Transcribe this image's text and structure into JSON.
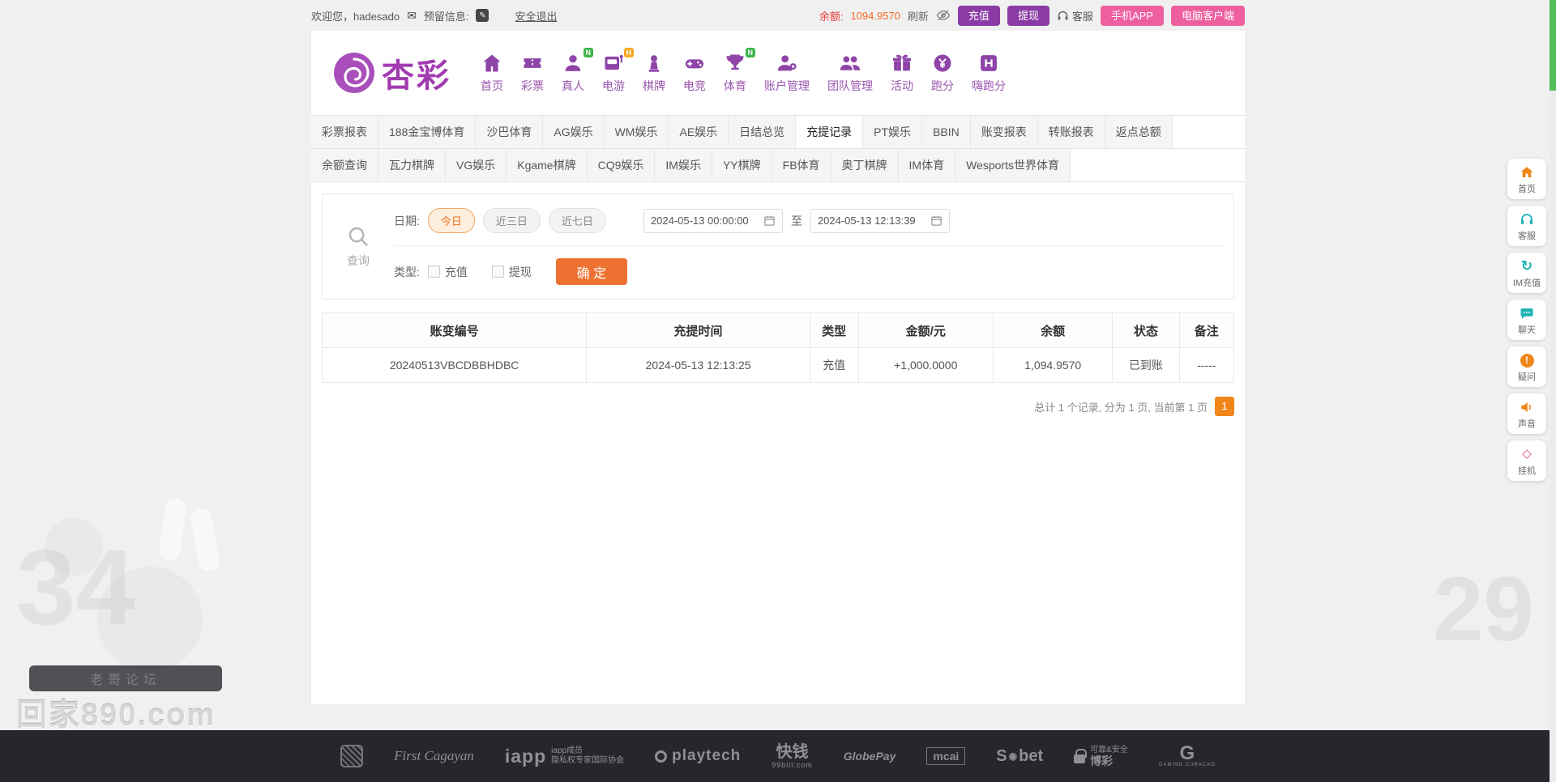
{
  "colors": {
    "accent_purple": "#8a3ba5",
    "accent_pink": "#ee5fa0",
    "accent_orange": "#f08519",
    "amount_red": "#e0262b",
    "status_green": "#3ba54d"
  },
  "topbar": {
    "welcome": "欢迎您，hadesado",
    "reserved_label": "预留信息:",
    "logout": "安全退出",
    "balance_label": "余额:",
    "balance_value": "1094.9570",
    "refresh": "刷新",
    "deposit": "充值",
    "withdraw": "提现",
    "service": "客服",
    "mobile_app": "手机APP",
    "pc_client": "电脑客户端"
  },
  "brand": {
    "name": "杏彩"
  },
  "nav": {
    "items": [
      {
        "label": "首页",
        "badge": ""
      },
      {
        "label": "彩票",
        "badge": ""
      },
      {
        "label": "真人",
        "badge": "N"
      },
      {
        "label": "电游",
        "badge": "H"
      },
      {
        "label": "棋牌",
        "badge": ""
      },
      {
        "label": "电竞",
        "badge": ""
      },
      {
        "label": "体育",
        "badge": "N"
      },
      {
        "label": "账户管理",
        "badge": ""
      },
      {
        "label": "团队管理",
        "badge": ""
      },
      {
        "label": "活动",
        "badge": ""
      },
      {
        "label": "跑分",
        "badge": ""
      },
      {
        "label": "嗨跑分",
        "badge": ""
      }
    ]
  },
  "tabs": {
    "row1": [
      "彩票报表",
      "188金宝博体育",
      "沙巴体育",
      "AG娱乐",
      "WM娱乐",
      "AE娱乐",
      "日结总览",
      "充提记录",
      "PT娱乐",
      "BBIN",
      "账变报表",
      "转账报表",
      "返点总额"
    ],
    "row2": [
      "余额查询",
      "瓦力棋牌",
      "VG娱乐",
      "Kgame棋牌",
      "CQ9娱乐",
      "IM娱乐",
      "YY棋牌",
      "FB体育",
      "奥丁棋牌",
      "IM体育",
      "Wesports世界体育"
    ]
  },
  "filter": {
    "search_label": "查询",
    "date_label": "日期:",
    "quick": [
      "今日",
      "近三日",
      "近七日"
    ],
    "date_from": "2024-05-13 00:00:00",
    "to_label": "至",
    "date_to": "2024-05-13 12:13:39",
    "type_label": "类型:",
    "types": [
      "充值",
      "提现"
    ],
    "confirm": "确 定"
  },
  "table": {
    "headers": [
      "账变编号",
      "充提时间",
      "类型",
      "金额/元",
      "余额",
      "状态",
      "备注"
    ],
    "rows": [
      {
        "id": "20240513VBCDBBHDBC",
        "time": "2024-05-13 12:13:25",
        "type": "充值",
        "amount": "+1,000.0000",
        "balance": "1,094.9570",
        "status": "已到账",
        "remark": "-----"
      }
    ]
  },
  "pagination": {
    "summary": "总计 1 个记录, 分为 1 页, 当前第 1 页",
    "current": "1"
  },
  "side_nav": {
    "items": [
      {
        "label": "首页"
      },
      {
        "label": "客服"
      },
      {
        "label": "IM充值"
      },
      {
        "label": "聊天"
      },
      {
        "label": "疑问"
      },
      {
        "label": "声音"
      },
      {
        "label": "挂机"
      }
    ]
  },
  "footer": {
    "first_cagayan": "First Cagayan",
    "iapp": "iapp",
    "iapp_line1": "iapp成员",
    "iapp_line2": "隐私权专家国际协会",
    "playtech": "playtech",
    "kuaiqian": "快钱",
    "kuaiqian_sub": "99bill.com",
    "globepay": "GlobePay",
    "mcai": "mcai",
    "sbet_s": "S",
    "sbet_bet": "bet",
    "safe_line1": "可靠&安全",
    "safe_line2": "博彩",
    "gc": "G",
    "gc_sub": "GAMING CURACAO"
  },
  "watermark": {
    "pill": "老哥论坛",
    "site": "回家890.com"
  },
  "decor": {
    "left_num": "34",
    "right_num": "29"
  }
}
